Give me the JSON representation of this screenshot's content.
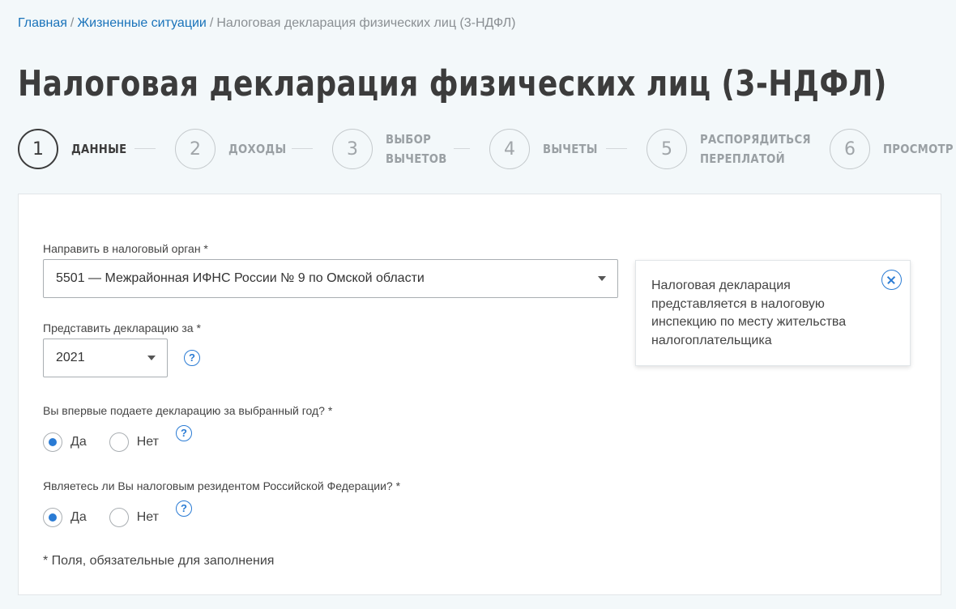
{
  "breadcrumb": {
    "home": "Главная",
    "separator": "/",
    "situations": "Жизненные ситуации",
    "current": "Налоговая декларация физических лиц (3-НДФЛ)"
  },
  "page_title": "Налоговая декларация физических лиц (3-НДФЛ)",
  "stepper": {
    "active_step": 1,
    "steps": [
      {
        "number": "1",
        "label": "ДАННЫЕ"
      },
      {
        "number": "2",
        "label": "ДОХОДЫ"
      },
      {
        "number": "3",
        "label": "ВЫБОР\nВЫЧЕТОВ"
      },
      {
        "number": "4",
        "label": "ВЫЧЕТЫ"
      },
      {
        "number": "5",
        "label": "РАСПОРЯДИТЬСЯ\nПЕРЕПЛАТОЙ"
      },
      {
        "number": "6",
        "label": "ПРОСМОТР"
      }
    ]
  },
  "form": {
    "tax_office": {
      "label": "Направить в налоговый орган *",
      "value": "5501 — Межрайонная ИФНС России № 9 по Омской области"
    },
    "year": {
      "label": "Представить декларацию за *",
      "value": "2021",
      "help": "?"
    },
    "first_time": {
      "label": "Вы впервые подаете декларацию за выбранный год? *",
      "options": [
        "Да",
        "Нет"
      ],
      "selected": "Да",
      "help": "?"
    },
    "resident": {
      "label": "Являетесь ли Вы налоговым резидентом Российской Федерации? *",
      "options": [
        "Да",
        "Нет"
      ],
      "selected": "Да",
      "help": "?"
    },
    "required_note": "* Поля, обязательные для заполнения"
  },
  "tooltip": {
    "text": "Налоговая декларация представляется в налоговую инспекцию по месту жительства налогоплательщика"
  },
  "colors": {
    "link": "#1a73ba",
    "accent": "#2a7bd4",
    "title": "#3c3c3c",
    "background": "#f3f8fa"
  }
}
